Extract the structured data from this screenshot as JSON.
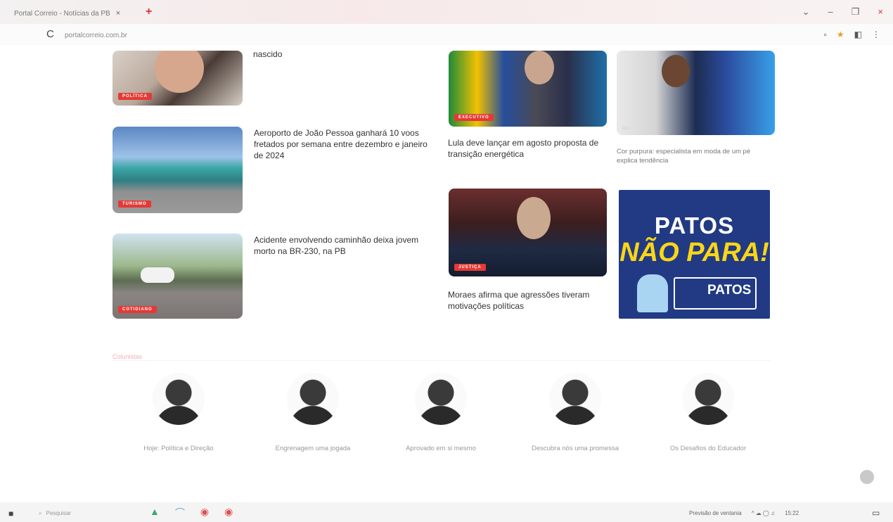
{
  "browser": {
    "tab_title": "Portal Correio - Notícias da PB",
    "tab_close": "×",
    "new_tab": "+",
    "url": "portalcorreio.com.br",
    "reload": "C",
    "win_min": "–",
    "win_max": "❐",
    "win_close": "×",
    "win_chevron": "⌄"
  },
  "articles": [
    {
      "tag": "POLÍTICA",
      "headline": "nascido",
      "sub": ""
    },
    {
      "tag": "TURISMO",
      "headline": "Aeroporto de João Pessoa ganhará 10 voos fretados por semana entre dezembro e janeiro de 2024",
      "sub": ""
    },
    {
      "tag": "COTIDIANO",
      "headline": "Acidente envolvendo caminhão deixa jovem morto na BR-230, na PB",
      "sub": ""
    },
    {
      "tag": "EXECUTIVO",
      "headline": "Lula deve lançar em agosto proposta de transição energética"
    },
    {
      "tag": "",
      "headline": "Cor purpura: especialista em moda de um pé explica tendência"
    },
    {
      "tag": "JUSTIÇA",
      "headline": "Moraes afirma que agressões tiveram motivações políticas"
    }
  ],
  "ad": {
    "line1": "PATOS",
    "line2": "NÃO PARA!",
    "logo_text": "PATOS"
  },
  "columnists": {
    "label": "Colunistas",
    "items": [
      {
        "name": "",
        "title": "Hoje: Política e Direção"
      },
      {
        "name": "",
        "title": "Engrenagem uma jogada"
      },
      {
        "name": "",
        "title": "Aprovado em si mesmo"
      },
      {
        "name": "",
        "title": "Descubra nós uma promessa"
      },
      {
        "name": "",
        "title": "Os Desafios do Educador"
      }
    ]
  },
  "taskbar": {
    "start": "■",
    "search_icon": "⌕",
    "search_placeholder": "Pesquisar",
    "weather": "Previsão de ventania",
    "tray_icons": "^ ☁ ◯ ♫",
    "clock": "15:22",
    "notif": "▭"
  }
}
